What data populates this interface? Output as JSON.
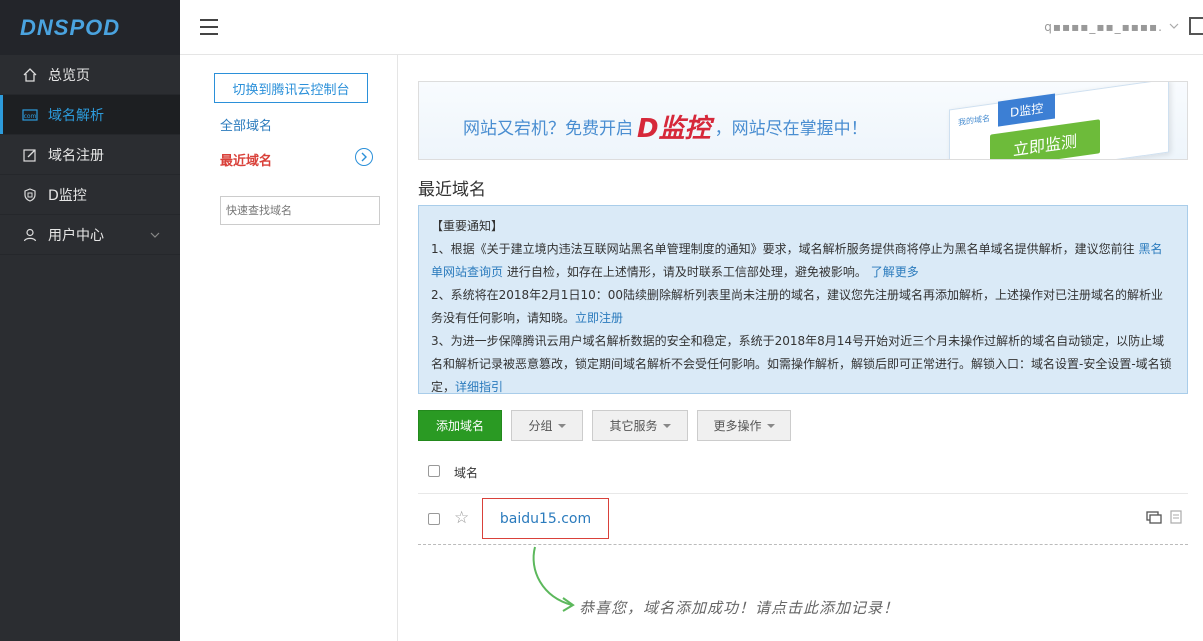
{
  "brand": "DNSPOD",
  "sidebar": {
    "items": [
      {
        "label": "总览页",
        "icon": "home-icon"
      },
      {
        "label": "域名解析",
        "icon": "com-icon"
      },
      {
        "label": "域名注册",
        "icon": "edit-icon"
      },
      {
        "label": "D监控",
        "icon": "shield-icon"
      },
      {
        "label": "用户中心",
        "icon": "user-icon"
      }
    ],
    "active": "域名解析"
  },
  "topbar": {
    "username": "q▪▪▪▪_▪▪_▪▪▪▪.",
    "menu_icon": "hamburger-icon"
  },
  "subnav": {
    "switch_button": "切换到腾讯云控制台",
    "all_domains": "全部域名",
    "recent_domains": "最近域名",
    "search_placeholder": "快速查找域名"
  },
  "banner": {
    "text_before": "网站又宕机？免费开启",
    "brand_mark": "D监控",
    "text_after": "，网站尽在掌握中！",
    "card_tab": "D监控",
    "card_button": "立即监测",
    "card_small": "我的域名"
  },
  "main": {
    "title": "最近域名"
  },
  "notice": {
    "heading": "【重要通知】",
    "p1_a": "1、根据《关于建立境内违法互联网站黑名单管理制度的通知》要求，域名解析服务提供商将停止为黑名单域名提供解析，建议您前往",
    "p1_link1": "黑名单网站查询页",
    "p1_b": "进行自检，如存在上述情形，请及时联系工信部处理，避免被影响。",
    "p1_link2": "了解更多",
    "p2_a": "2、系统将在2018年2月1日10：00陆续删除解析列表里尚未注册的域名，建议您先注册域名再添加解析，上述操作对已注册域名的解析业务没有任何影响，请知晓。",
    "p2_link": "立即注册",
    "p3_a": "3、为进一步保障腾讯云用户域名解析数据的安全和稳定，系统于2018年8月14号开始对近三个月未操作过解析的域名自动锁定，以防止域名和解析记录被恶意篡改，锁定期间域名解析不会受任何影响。如需操作解析，解锁后即可正常进行。解锁入口：域名设置-安全设置-域名锁定，",
    "p3_link": "详细指引"
  },
  "actions": {
    "add_domain": "添加域名",
    "group": "分组",
    "other_services": "其它服务",
    "more_actions": "更多操作"
  },
  "table": {
    "header": "域名",
    "rows": [
      {
        "domain": "baidu15.com"
      }
    ]
  },
  "success_message": "恭喜您，域名添加成功！请点击此添加记录！"
}
